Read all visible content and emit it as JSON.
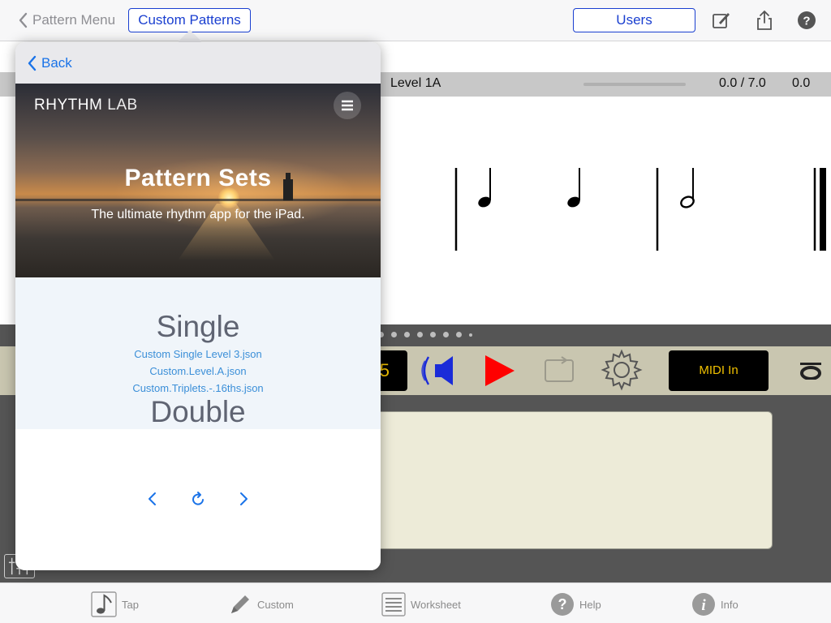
{
  "nav": {
    "back_label": "Pattern Menu",
    "active_segment": "Custom Patterns",
    "users_label": "Users",
    "icons": [
      "compose-icon",
      "share-icon",
      "help-icon"
    ]
  },
  "level": {
    "name": "Level 1A",
    "progress": 0,
    "score": "0.0 / 7.0",
    "time": "0.0"
  },
  "controls": {
    "tempo": "5",
    "midi_label": "MIDI In",
    "pager_dots": 8
  },
  "popover": {
    "back_label": "Back",
    "brand_bold": "RHYTHM",
    "brand_light": "LAB",
    "title": "Pattern Sets",
    "subtitle": "The ultimate rhythm app for the iPad.",
    "single_heading": "Single",
    "single_items": [
      "Custom Single Level 3.json",
      "Custom.Level.A.json",
      "Custom.Triplets.-.16ths.json"
    ],
    "double_heading": "Double"
  },
  "tabs": [
    {
      "label": "Tap",
      "icon": "note-icon"
    },
    {
      "label": "Custom",
      "icon": "pencil-icon"
    },
    {
      "label": "Worksheet",
      "icon": "list-icon"
    },
    {
      "label": "Help",
      "icon": "question-icon"
    },
    {
      "label": "Info",
      "icon": "info-icon"
    }
  ],
  "colors": {
    "accent": "#1a3fd0",
    "link": "#3b8fd8",
    "play": "#ff0000",
    "midi_text": "#f0c000",
    "workpad": "#edebd8"
  }
}
